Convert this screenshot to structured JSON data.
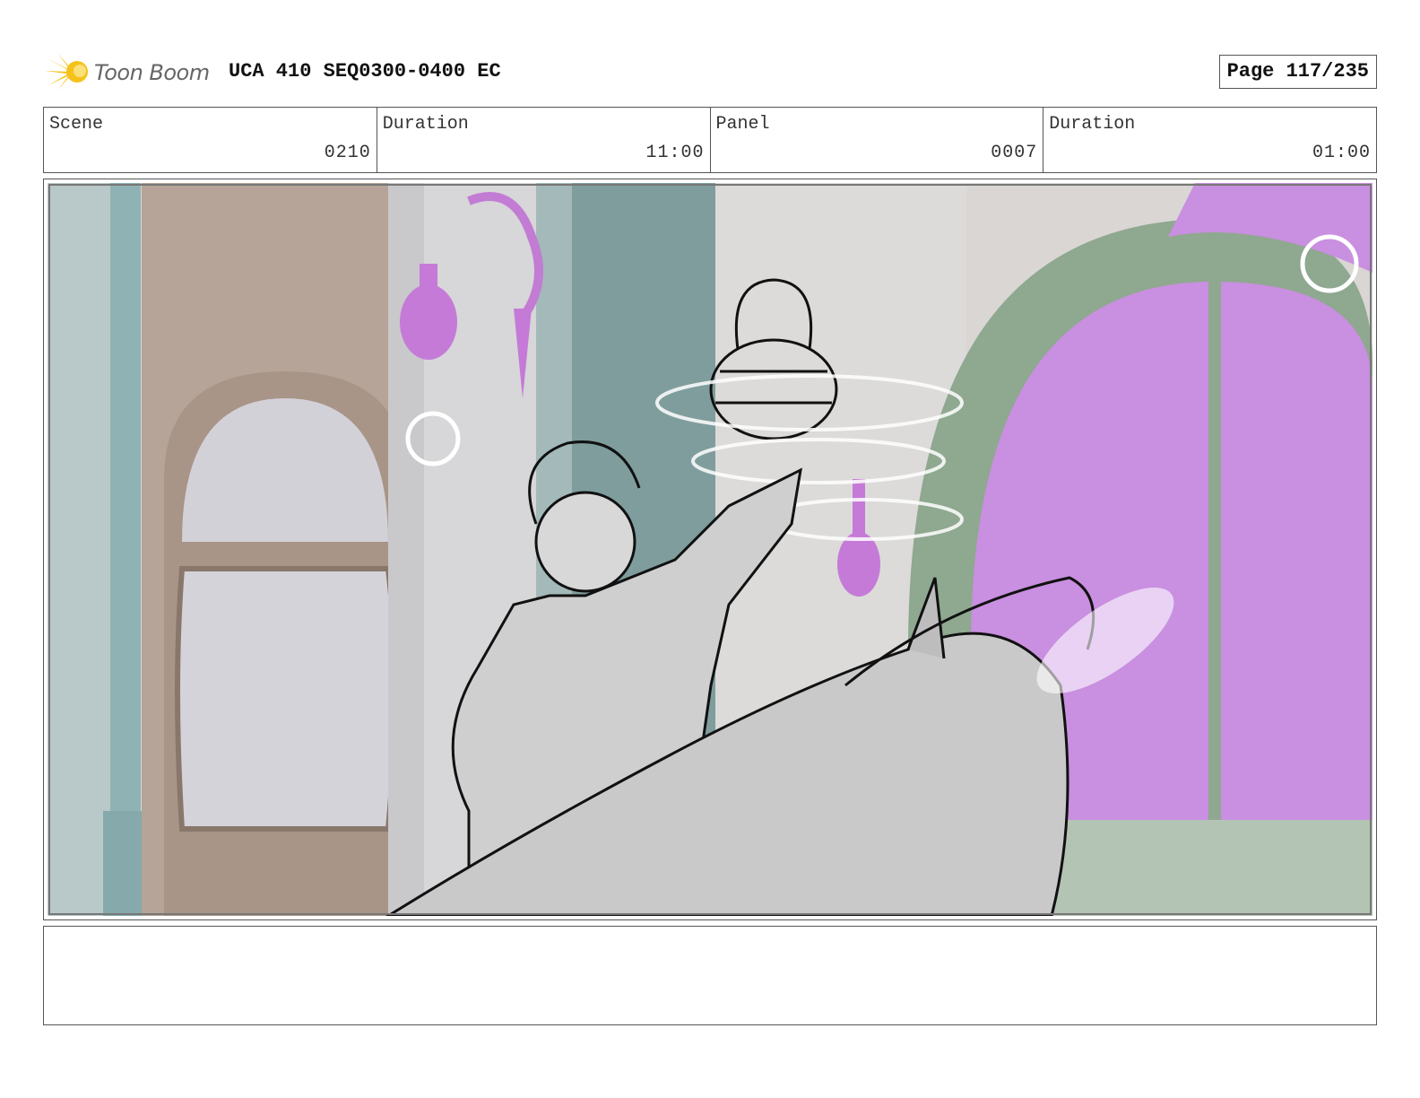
{
  "header": {
    "logo_text": "Toon Boom",
    "project_title": "UCA 410 SEQ0300-0400 EC",
    "page_label": "Page 117/235"
  },
  "info": {
    "scene_label": "Scene",
    "scene_value": "0210",
    "scene_duration_label": "Duration",
    "scene_duration_value": "11:00",
    "panel_label": "Panel",
    "panel_value": "0007",
    "panel_duration_label": "Duration",
    "panel_duration_value": "01:00"
  },
  "notes": {
    "text": ""
  },
  "colors": {
    "logo_yellow": "#f5c21b",
    "magenta_accent": "#c98fe0",
    "arch_green": "#8fa890",
    "wall_brown": "#b3a296"
  }
}
